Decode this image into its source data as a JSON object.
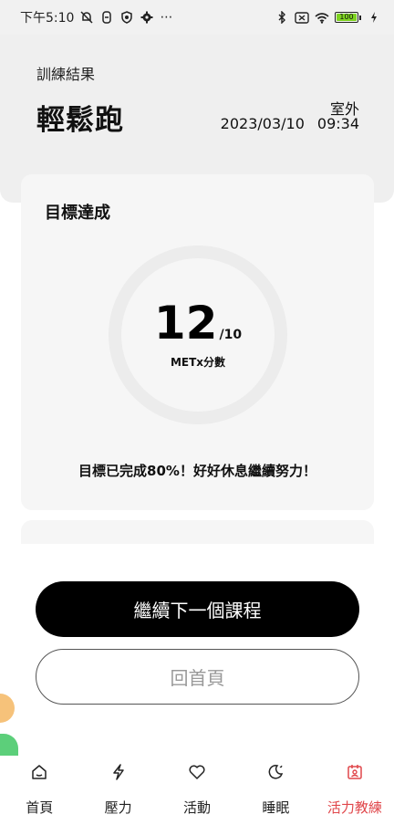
{
  "status_bar": {
    "time": "下午5:10",
    "more": "⋯",
    "battery_level": "100"
  },
  "header": {
    "label": "訓練結果",
    "title": "輕鬆跑",
    "location": "室外",
    "date": "2023/03/10",
    "time": "09:34"
  },
  "goal": {
    "title": "目標達成",
    "score": "12",
    "target": "/10",
    "score_label": "METx分數",
    "message": "目標已完成80%！好好休息繼續努力！"
  },
  "actions": {
    "next_course": "繼續下一個課程",
    "home": "回首頁"
  },
  "nav": {
    "items": [
      {
        "label": "首頁",
        "icon": "home-icon"
      },
      {
        "label": "壓力",
        "icon": "lightning-icon"
      },
      {
        "label": "活動",
        "icon": "heart-icon"
      },
      {
        "label": "睡眠",
        "icon": "moon-icon"
      },
      {
        "label": "活力教練",
        "icon": "coach-icon"
      }
    ],
    "active_index": 4,
    "active_color": "#e0464a"
  }
}
